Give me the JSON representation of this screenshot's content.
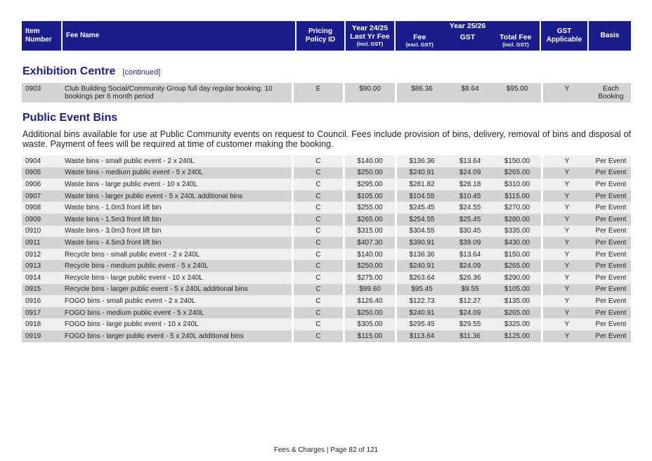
{
  "header": {
    "item_number": [
      "Item",
      "Number"
    ],
    "fee_name": "Fee Name",
    "pricing_policy": [
      "Pricing",
      "Policy ID"
    ],
    "year_prev": "Year 24/25",
    "last_yr_fee": "Last Yr Fee",
    "incl_gst": "(incl. GST)",
    "year_curr": "Year 25/26",
    "fee": "Fee",
    "excl_gst": "(excl. GST)",
    "gst": "GST",
    "total_fee": "Total Fee",
    "total_incl_gst": "(incl. GST)",
    "gst_applicable": [
      "GST",
      "Applicable"
    ],
    "basis": "Basis"
  },
  "section1": {
    "title": "Exhibition Centre",
    "continued": "[continued]",
    "rows": [
      {
        "item": "0903",
        "name": "Club Building Social/Community Group full day regular booking. 10 bookings per 6 month period",
        "policy": "E",
        "last": "$90.00",
        "fee": "$86.36",
        "gst": "$8.64",
        "total": "$95.00",
        "gst_app": "Y",
        "basis": "Each Booking"
      }
    ]
  },
  "section2": {
    "title": "Public Event Bins",
    "description": "Additional bins available for use at Public Community events on request to Council. Fees include provision of bins, delivery, removal of bins and disposal of waste. Payment of fees will be required at time of customer making the booking.",
    "rows": [
      {
        "item": "0904",
        "name": "Waste bins - small public event - 2 x 240L",
        "policy": "C",
        "last": "$140.00",
        "fee": "$136.36",
        "gst": "$13.64",
        "total": "$150.00",
        "gst_app": "Y",
        "basis": "Per Event"
      },
      {
        "item": "0905",
        "name": "Waste bins - medium public event - 5 x 240L",
        "policy": "C",
        "last": "$250.00",
        "fee": "$240.91",
        "gst": "$24.09",
        "total": "$265.00",
        "gst_app": "Y",
        "basis": "Per Event"
      },
      {
        "item": "0906",
        "name": "Waste bins - large public event - 10 x 240L",
        "policy": "C",
        "last": "$295.00",
        "fee": "$281.82",
        "gst": "$28.18",
        "total": "$310.00",
        "gst_app": "Y",
        "basis": "Per Event"
      },
      {
        "item": "0907",
        "name": "Waste bins - larger public event - 5 x 240L additional bins",
        "policy": "C",
        "last": "$105.00",
        "fee": "$104.55",
        "gst": "$10.45",
        "total": "$115.00",
        "gst_app": "Y",
        "basis": "Per Event"
      },
      {
        "item": "0908",
        "name": "Waste bins - 1.0m3 front lift bin",
        "policy": "C",
        "last": "$255.00",
        "fee": "$245.45",
        "gst": "$24.55",
        "total": "$270.00",
        "gst_app": "Y",
        "basis": "Per Event"
      },
      {
        "item": "0909",
        "name": "Waste bins - 1.5m3 front lift bin",
        "policy": "C",
        "last": "$265.00",
        "fee": "$254.55",
        "gst": "$25.45",
        "total": "$280.00",
        "gst_app": "Y",
        "basis": "Per Event"
      },
      {
        "item": "0910",
        "name": "Waste bins - 3.0m3 front lift bin",
        "policy": "C",
        "last": "$315.00",
        "fee": "$304.55",
        "gst": "$30.45",
        "total": "$335.00",
        "gst_app": "Y",
        "basis": "Per Event"
      },
      {
        "item": "0911",
        "name": "Waste bins - 4.5m3 front lift bin",
        "policy": "C",
        "last": "$407.30",
        "fee": "$390.91",
        "gst": "$39.09",
        "total": "$430.00",
        "gst_app": "Y",
        "basis": "Per Event"
      },
      {
        "item": "0912",
        "name": "Recycle bins - small public event - 2 x 240L",
        "policy": "C",
        "last": "$140.00",
        "fee": "$136.36",
        "gst": "$13.64",
        "total": "$150.00",
        "gst_app": "Y",
        "basis": "Per Event"
      },
      {
        "item": "0913",
        "name": "Recycle bins - medium public event - 5 x 240L",
        "policy": "C",
        "last": "$250.00",
        "fee": "$240.91",
        "gst": "$24.09",
        "total": "$265.00",
        "gst_app": "Y",
        "basis": "Per Event"
      },
      {
        "item": "0914",
        "name": "Recycle bins - large public event - 10 x 240L",
        "policy": "C",
        "last": "$275.00",
        "fee": "$263.64",
        "gst": "$26.36",
        "total": "$290.00",
        "gst_app": "Y",
        "basis": "Per Event"
      },
      {
        "item": "0915",
        "name": "Recycle bins - larger public event - 5 x 240L additional bins",
        "policy": "C",
        "last": "$99.60",
        "fee": "$95.45",
        "gst": "$9.55",
        "total": "$105.00",
        "gst_app": "Y",
        "basis": "Per Event"
      },
      {
        "item": "0916",
        "name": "FOGO bins - small public event - 2 x 240L",
        "policy": "C",
        "last": "$126.40",
        "fee": "$122.73",
        "gst": "$12.27",
        "total": "$135.00",
        "gst_app": "Y",
        "basis": "Per Event"
      },
      {
        "item": "0917",
        "name": "FOGO bins - medium public event - 5 x 240L",
        "policy": "C",
        "last": "$250.00",
        "fee": "$240.91",
        "gst": "$24.09",
        "total": "$265.00",
        "gst_app": "Y",
        "basis": "Per Event"
      },
      {
        "item": "0918",
        "name": "FOGO bins - large public event - 10 x 240L",
        "policy": "C",
        "last": "$305.00",
        "fee": "$295.45",
        "gst": "$29.55",
        "total": "$325.00",
        "gst_app": "Y",
        "basis": "Per Event"
      },
      {
        "item": "0919",
        "name": "FOGO bins - larger public event - 5 x 240L additional bins",
        "policy": "C",
        "last": "$115.00",
        "fee": "$113.64",
        "gst": "$11.36",
        "total": "$125.00",
        "gst_app": "Y",
        "basis": "Per Event"
      }
    ]
  },
  "footer": "Fees & Charges | Page 82 of 121"
}
